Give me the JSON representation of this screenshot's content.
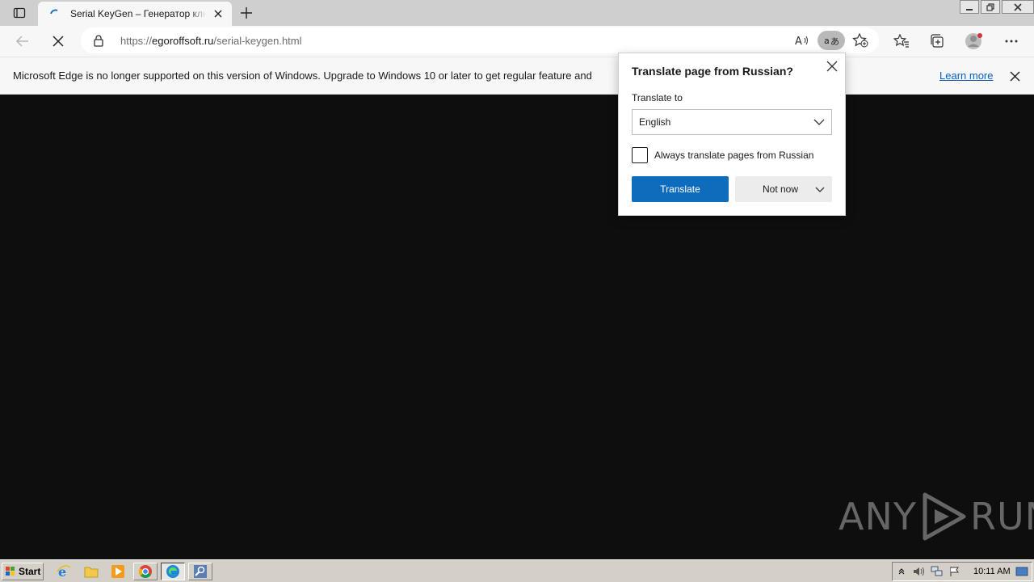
{
  "tab": {
    "title": "Serial KeyGen – Генератор ключе",
    "favicon": "loading-spinner-icon"
  },
  "address_bar": {
    "url_scheme": "https://",
    "url_host": "egoroffsoft.ru",
    "url_path": "/serial-keygen.html"
  },
  "infobar": {
    "message": "Microsoft Edge is no longer supported on this version of Windows. Upgrade to Windows 10 or later to get regular feature and",
    "link": "Learn more"
  },
  "translate_popup": {
    "title": "Translate page from Russian?",
    "label": "Translate to",
    "selected_language": "English",
    "checkbox_label": "Always translate pages from Russian",
    "checkbox_checked": false,
    "primary_button": "Translate",
    "secondary_button": "Not now"
  },
  "watermark": {
    "text_left": "ANY",
    "text_right": "RUN"
  },
  "taskbar": {
    "start_label": "Start",
    "clock": "10:11 AM"
  },
  "colors": {
    "accent": "#0f6cbd",
    "page_bg": "#0e0e0e"
  }
}
